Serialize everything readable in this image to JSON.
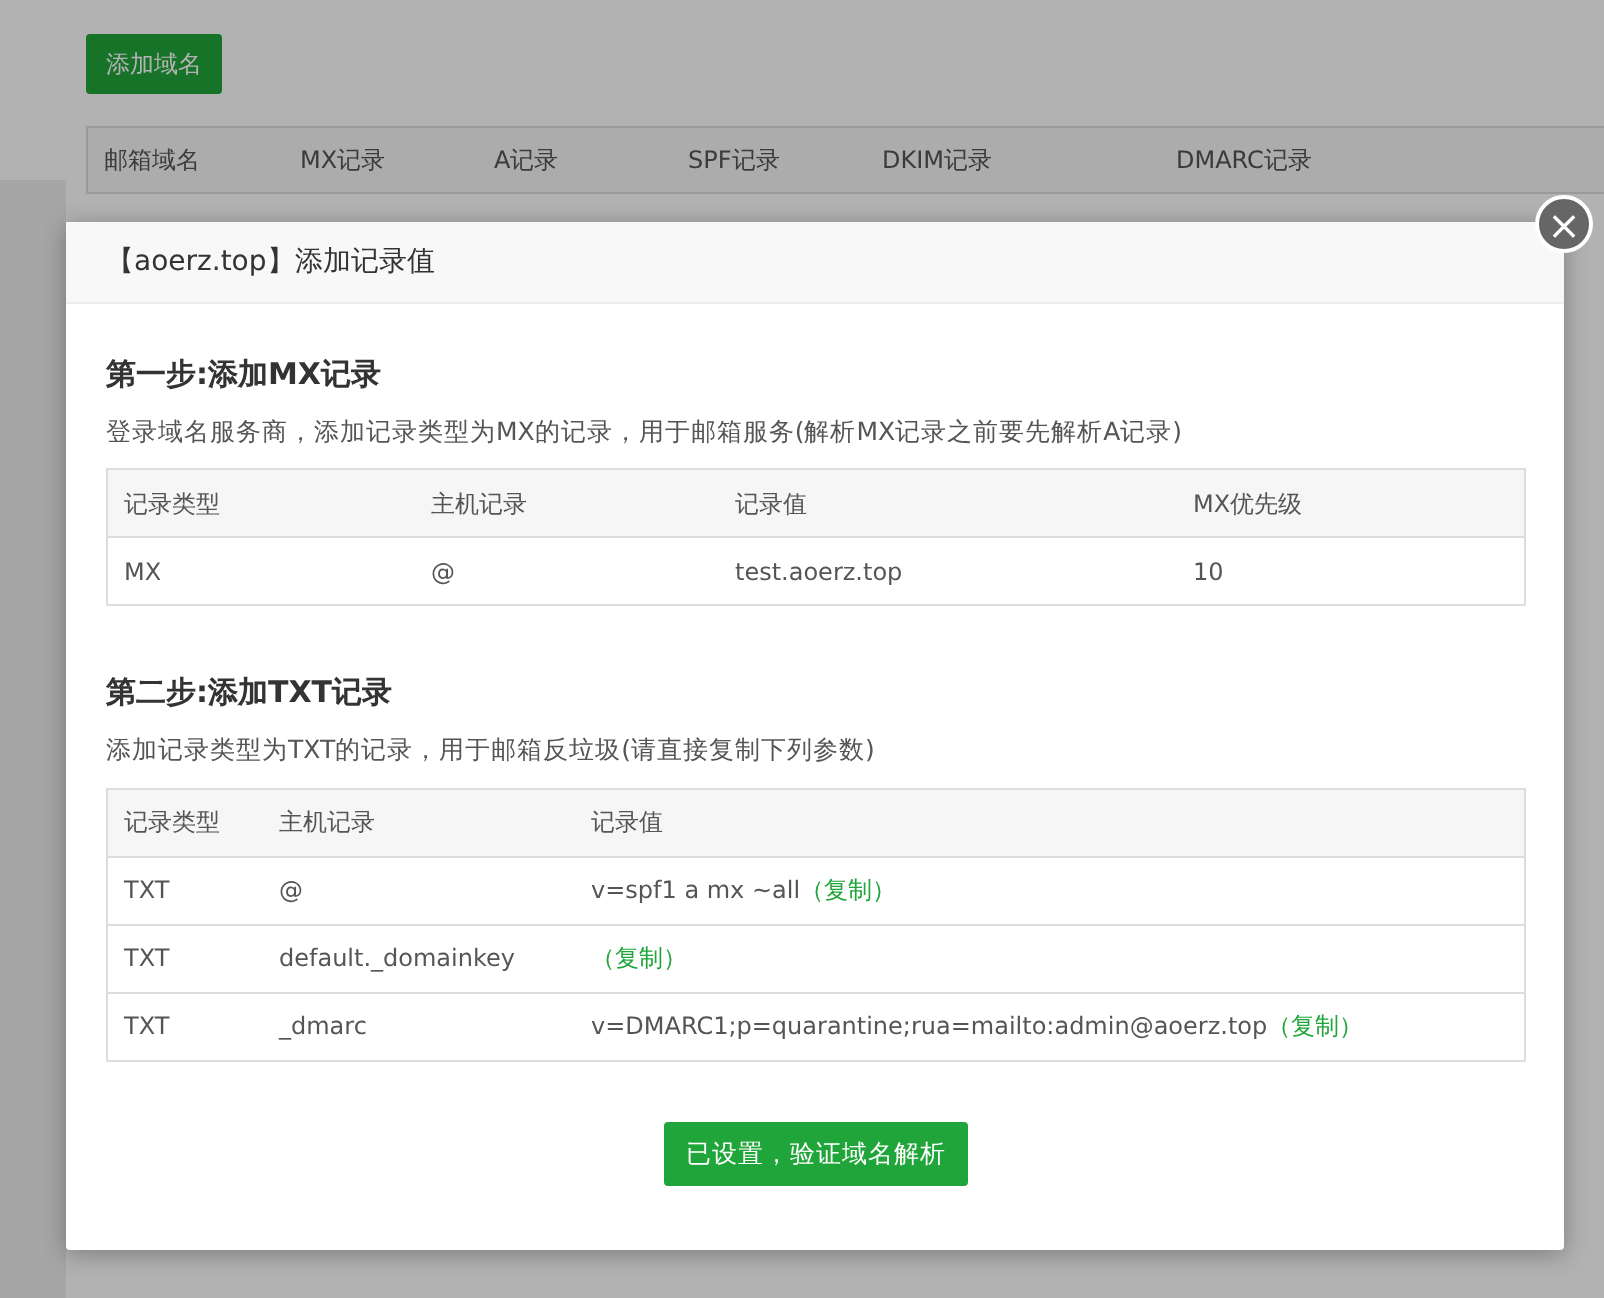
{
  "page": {
    "add_button": "添加域名",
    "table_columns": [
      "邮箱域名",
      "MX记录",
      "A记录",
      "SPF记录",
      "DKIM记录",
      "DMARC记录"
    ]
  },
  "modal": {
    "title": "【aoerz.top】添加记录值",
    "close": "×",
    "steps": [
      {
        "heading": "第一步:添加MX记录",
        "description": "登录域名服务商，添加记录类型为MX的记录，用于邮箱服务(解析MX记录之前要先解析A记录)",
        "columns": [
          "记录类型",
          "主机记录",
          "记录值",
          "MX优先级"
        ],
        "rows": [
          {
            "cells": [
              "MX",
              "@",
              "test.aoerz.top",
              "10"
            ]
          }
        ]
      },
      {
        "heading": "第二步:添加TXT记录",
        "description": "添加记录类型为TXT的记录，用于邮箱反垃圾(请直接复制下列参数)",
        "columns": [
          "记录类型",
          "主机记录",
          "记录值"
        ],
        "rows": [
          {
            "cells": [
              "TXT",
              "@",
              "v=spf1 a mx ~all"
            ],
            "copy": "（复制）"
          },
          {
            "cells": [
              "TXT",
              "default._domainkey",
              ""
            ],
            "copy": "（复制）"
          },
          {
            "cells": [
              "TXT",
              "_dmarc",
              "v=DMARC1;p=quarantine;rua=mailto:admin@aoerz.top"
            ],
            "copy": "（复制）"
          }
        ]
      }
    ],
    "confirm_button": "已设置，验证域名解析"
  }
}
